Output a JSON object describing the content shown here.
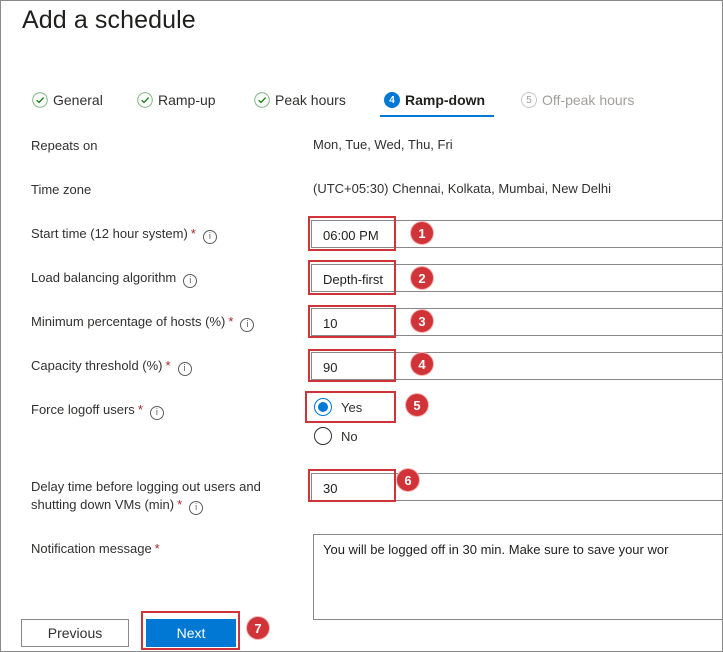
{
  "page": {
    "title": "Add a schedule"
  },
  "tabs": [
    {
      "label": "General",
      "state": "complete",
      "icon": "check-circle-icon"
    },
    {
      "label": "Ramp-up",
      "state": "complete",
      "icon": "check-circle-icon"
    },
    {
      "label": "Peak hours",
      "state": "complete",
      "icon": "check-circle-icon"
    },
    {
      "label": "Ramp-down",
      "state": "active",
      "number": "4"
    },
    {
      "label": "Off-peak hours",
      "state": "disabled",
      "number": "5"
    }
  ],
  "form": {
    "repeats_on": {
      "label": "Repeats on",
      "value": "Mon, Tue, Wed, Thu, Fri"
    },
    "time_zone": {
      "label": "Time zone",
      "value": "(UTC+05:30) Chennai, Kolkata, Mumbai, New Delhi"
    },
    "start_time": {
      "label": "Start time (12 hour system)",
      "required": "*",
      "value": "06:00 PM"
    },
    "load_balancing": {
      "label": "Load balancing algorithm",
      "value": "Depth-first"
    },
    "min_hosts": {
      "label": "Minimum percentage of hosts (%)",
      "required": "*",
      "value": "10"
    },
    "capacity": {
      "label": "Capacity threshold (%)",
      "required": "*",
      "value": "90"
    },
    "force_logoff": {
      "label": "Force logoff users",
      "required": "*",
      "options": [
        "Yes",
        "No"
      ],
      "selected": "Yes"
    },
    "delay": {
      "label_line1": "Delay time before logging out users and",
      "label_line2": "shutting down VMs (min)",
      "required": "*",
      "value": "30"
    },
    "notification": {
      "label": "Notification message",
      "required": "*",
      "value": "You will be logged off in 30 min. Make sure to save your wor"
    }
  },
  "info_glyph": "i",
  "callouts": [
    "1",
    "2",
    "3",
    "4",
    "5",
    "6",
    "7"
  ],
  "buttons": {
    "previous": "Previous",
    "next": "Next"
  },
  "colors": {
    "accent": "#0078d4",
    "callout": "#d13438",
    "required": "#a4262c",
    "check": "#107c10"
  }
}
